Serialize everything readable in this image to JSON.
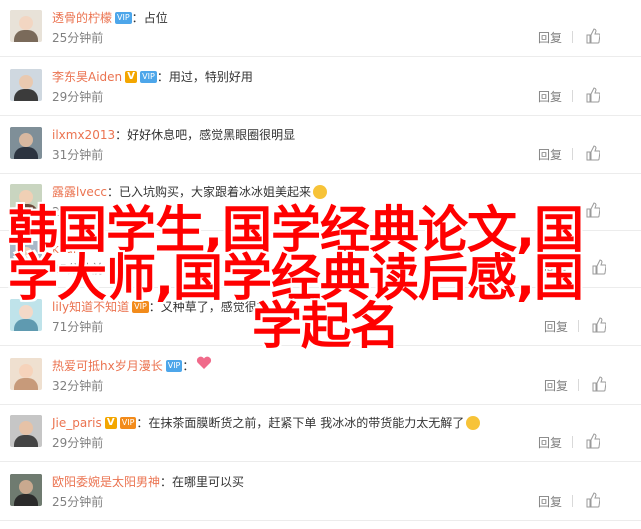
{
  "comments": [
    {
      "user": "透骨的柠檬",
      "text": "占位",
      "time": "25分钟前",
      "reply": "回复",
      "badge": "vip"
    },
    {
      "user": "李东昊Aiden",
      "text": "用过，特别好用",
      "time": "29分钟前",
      "reply": "回复",
      "badge": "v-vip"
    },
    {
      "user": "ilxmx2013",
      "text": "好好休息吧，感觉黑眼圈很明显",
      "time": "31分钟前",
      "reply": "回复",
      "badge": "none"
    },
    {
      "user": "露露lvecc",
      "text": "已入坑购买，大家跟着冰冰姐美起来",
      "time": "25分钟前",
      "reply": "回复",
      "badge": "none"
    },
    {
      "user": "kzuiI",
      "text": "",
      "time": "25分钟前",
      "reply": "回复",
      "badge": "none"
    },
    {
      "user": "lily知道不知道",
      "text": "又种草了，感觉很好",
      "time": "71分钟前",
      "reply": "回复",
      "badge": "vip-orange"
    },
    {
      "user": "热爱可抵hx岁月漫长",
      "text": "",
      "time": "32分钟前",
      "reply": "回复",
      "badge": "vip"
    },
    {
      "user": "Jie_paris",
      "text": "在抹茶面膜断货之前，赶紧下单 我冰冰的带货能力太无解了",
      "time": "29分钟前",
      "reply": "回复",
      "badge": "v-vip-orange"
    },
    {
      "user": "欧阳委婉是太阳男神",
      "text": "在哪里可以买",
      "time": "25分钟前",
      "reply": "回复",
      "badge": "none"
    }
  ],
  "vip_label": "VIP",
  "v_label": "V",
  "overlay": {
    "line1": "韩国学生,国学经典论文,国",
    "line2": "学大师,国学经典读后感,国",
    "line3": "学起名"
  },
  "colors": {
    "username": "#eb7350",
    "overlay": "#ff0000"
  }
}
